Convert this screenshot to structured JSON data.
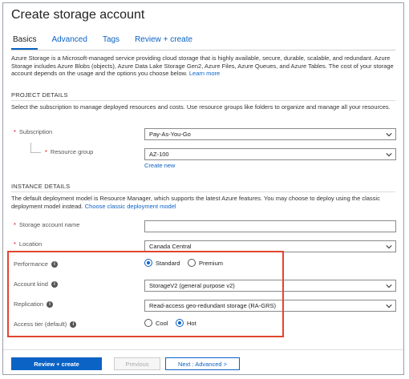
{
  "title": "Create storage account",
  "tabs": [
    "Basics",
    "Advanced",
    "Tags",
    "Review + create"
  ],
  "intro": {
    "text": "Azure Storage is a Microsoft-managed service providing cloud storage that is highly available, secure, durable, scalable, and redundant. Azure Storage includes Azure Blobs (objects), Azure Data Lake Storage Gen2, Azure Files, Azure Queues, and Azure Tables. The cost of your storage account depends on the usage and the options you choose below.",
    "link": "Learn more"
  },
  "project": {
    "heading": "PROJECT DETAILS",
    "desc": "Select the subscription to manage deployed resources and costs. Use resource groups like folders to organize and manage all your resources.",
    "subscription_label": "Subscription",
    "subscription_value": "Pay-As-You-Go",
    "resource_group_label": "Resource group",
    "resource_group_value": "AZ-100",
    "create_new": "Create new"
  },
  "instance": {
    "heading": "INSTANCE DETAILS",
    "desc": "The default deployment model is Resource Manager, which supports the latest Azure features. You may choose to deploy using the classic deployment model instead.",
    "desc_link": "Choose classic deployment model",
    "name_label": "Storage account name",
    "name_value": "",
    "location_label": "Location",
    "location_value": "Canada Central",
    "performance_label": "Performance",
    "performance_options": [
      "Standard",
      "Premium"
    ],
    "performance_selected": "Standard",
    "account_kind_label": "Account kind",
    "account_kind_value": "StorageV2 (general purpose v2)",
    "replication_label": "Replication",
    "replication_value": "Read-access geo-redundant storage (RA-GRS)",
    "access_tier_label": "Access tier (default)",
    "access_tier_options": [
      "Cool",
      "Hot"
    ],
    "access_tier_selected": "Hot"
  },
  "buttons": {
    "review_create": "Review + create",
    "previous": "Previous",
    "next": "Next : Advanced >"
  },
  "colors": {
    "accent": "#0b63c5",
    "highlight": "#e0452f",
    "required": "#cc0000"
  },
  "icons": {
    "info": "info-icon",
    "chevron": "chevron-down-icon"
  }
}
